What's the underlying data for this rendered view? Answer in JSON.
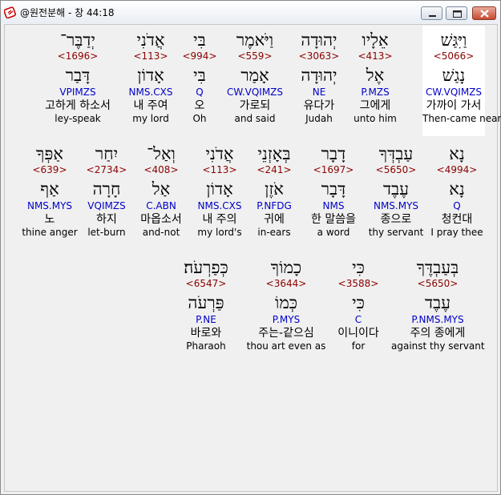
{
  "window": {
    "title": "@원전분해 - 창 44:18"
  },
  "rows": [
    [
      {
        "hebrew": "וַיִּגַּשׁ",
        "strong": "<5066>",
        "lemma": "נָגַשׁ",
        "morph": "CW.VQIMZS",
        "korean": "가까이 가서",
        "english": "Then-came near",
        "selected": true
      },
      {
        "hebrew": "אֵלָיו",
        "strong": "<413>",
        "lemma": "אֶל",
        "morph": "P.MZS",
        "korean": "그에게",
        "english": "unto him"
      },
      {
        "hebrew": "יְהוּדָה",
        "strong": "<3063>",
        "lemma": "יְהוּדָה",
        "morph": "NE",
        "korean": "유다가",
        "english": "Judah"
      },
      {
        "hebrew": "וַיֹּאמֶר",
        "strong": "<559>",
        "lemma": "אָמַר",
        "morph": "CW.VQIMZS",
        "korean": "가로되",
        "english": "and said"
      },
      {
        "hebrew": "בִּי",
        "strong": "<994>",
        "lemma": "בִּי",
        "morph": "Q",
        "korean": "오",
        "english": "Oh"
      },
      {
        "hebrew": "אֲדֹנִי",
        "strong": "<113>",
        "lemma": "אָדוֹן",
        "morph": "NMS.CXS",
        "korean": "내 주여",
        "english": "my lord"
      },
      {
        "hebrew": "יְדַבֶּר־",
        "strong": "<1696>",
        "lemma": "דָּבַר",
        "morph": "VPIMZS",
        "korean": "고하게 하소서",
        "english": "ley-speak"
      }
    ],
    [
      {
        "hebrew": "נָא",
        "strong": "<4994>",
        "lemma": "נָא",
        "morph": "Q",
        "korean": "청컨대",
        "english": "I pray thee"
      },
      {
        "hebrew": "עַבְדְּךָ",
        "strong": "<5650>",
        "lemma": "עֶבֶד",
        "morph": "NMS.MYS",
        "korean": "종으로",
        "english": "thy servant"
      },
      {
        "hebrew": "דָבָר",
        "strong": "<1697>",
        "lemma": "דָּבָר",
        "morph": "NMS",
        "korean": "한 말씀을",
        "english": "a word"
      },
      {
        "hebrew": "בְּאָזְנֵי",
        "strong": "<241>",
        "lemma": "אֹזֶן",
        "morph": "P.NFDG",
        "korean": "귀에",
        "english": "in-ears"
      },
      {
        "hebrew": "אֲדֹנִי",
        "strong": "<113>",
        "lemma": "אָדוֹן",
        "morph": "NMS.CXS",
        "korean": "내 주의",
        "english": "my lord's"
      },
      {
        "hebrew": "וְאַל־",
        "strong": "<408>",
        "lemma": "אַל",
        "morph": "C.ABN",
        "korean": "마옵소서",
        "english": "and-not"
      },
      {
        "hebrew": "יִחַר",
        "strong": "<2734>",
        "lemma": "חָרָה",
        "morph": "VQIMZS",
        "korean": "하지",
        "english": "let-burn"
      },
      {
        "hebrew": "אַפְּךָ",
        "strong": "<639>",
        "lemma": "אַף",
        "morph": "NMS.MYS",
        "korean": "노",
        "english": "thine anger"
      }
    ],
    [
      {
        "hebrew": "בְּעַבְדֶּךָ",
        "strong": "<5650>",
        "lemma": "עֶבֶד",
        "morph": "P.NMS.MYS",
        "korean": "주의 종에게",
        "english": "against thy servant"
      },
      {
        "hebrew": "כִּי",
        "strong": "<3588>",
        "lemma": "כִּי",
        "morph": "C",
        "korean": "이니이다",
        "english": "for"
      },
      {
        "hebrew": "כָמוֹךָ",
        "strong": "<3644>",
        "lemma": "כְּמוֹ",
        "morph": "P.MYS",
        "korean": "주는-같으심",
        "english": "thou art even as"
      },
      {
        "hebrew": "כְּפַרְעֹה׃",
        "strong": "<6547>",
        "lemma": "פַּרְעֹה",
        "morph": "P.NE",
        "korean": "바로와",
        "english": "Pharaoh"
      }
    ]
  ]
}
